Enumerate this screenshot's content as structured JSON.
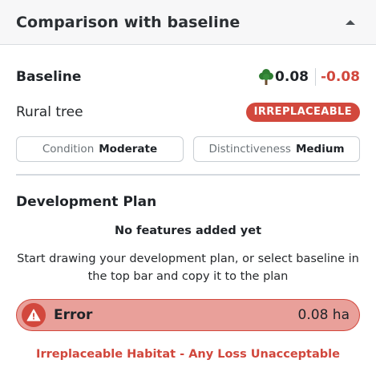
{
  "header": {
    "title": "Comparison with baseline",
    "collapse_icon": "chevron-up-icon"
  },
  "baseline": {
    "title": "Baseline",
    "value": "0.08",
    "delta": "-0.08",
    "tree_icon": "tree-icon",
    "habitat_name": "Rural tree",
    "badge": "IRREPLACEABLE",
    "condition_label": "Condition",
    "condition_value": "Moderate",
    "distinctiveness_label": "Distinctiveness",
    "distinctiveness_value": "Medium"
  },
  "development": {
    "title": "Development Plan",
    "empty_title": "No features added yet",
    "hint": "Start drawing your development plan, or select baseline in the top bar and copy it to the plan"
  },
  "error": {
    "label": "Error",
    "area": "0.08 ha",
    "icon": "warning-icon"
  },
  "warning_message": "Irreplaceable Habitat - Any Loss Unacceptable",
  "colors": {
    "accent_red": "#d2483d",
    "error_bg": "#e9a09a",
    "tree_green": "#2e7d32"
  }
}
